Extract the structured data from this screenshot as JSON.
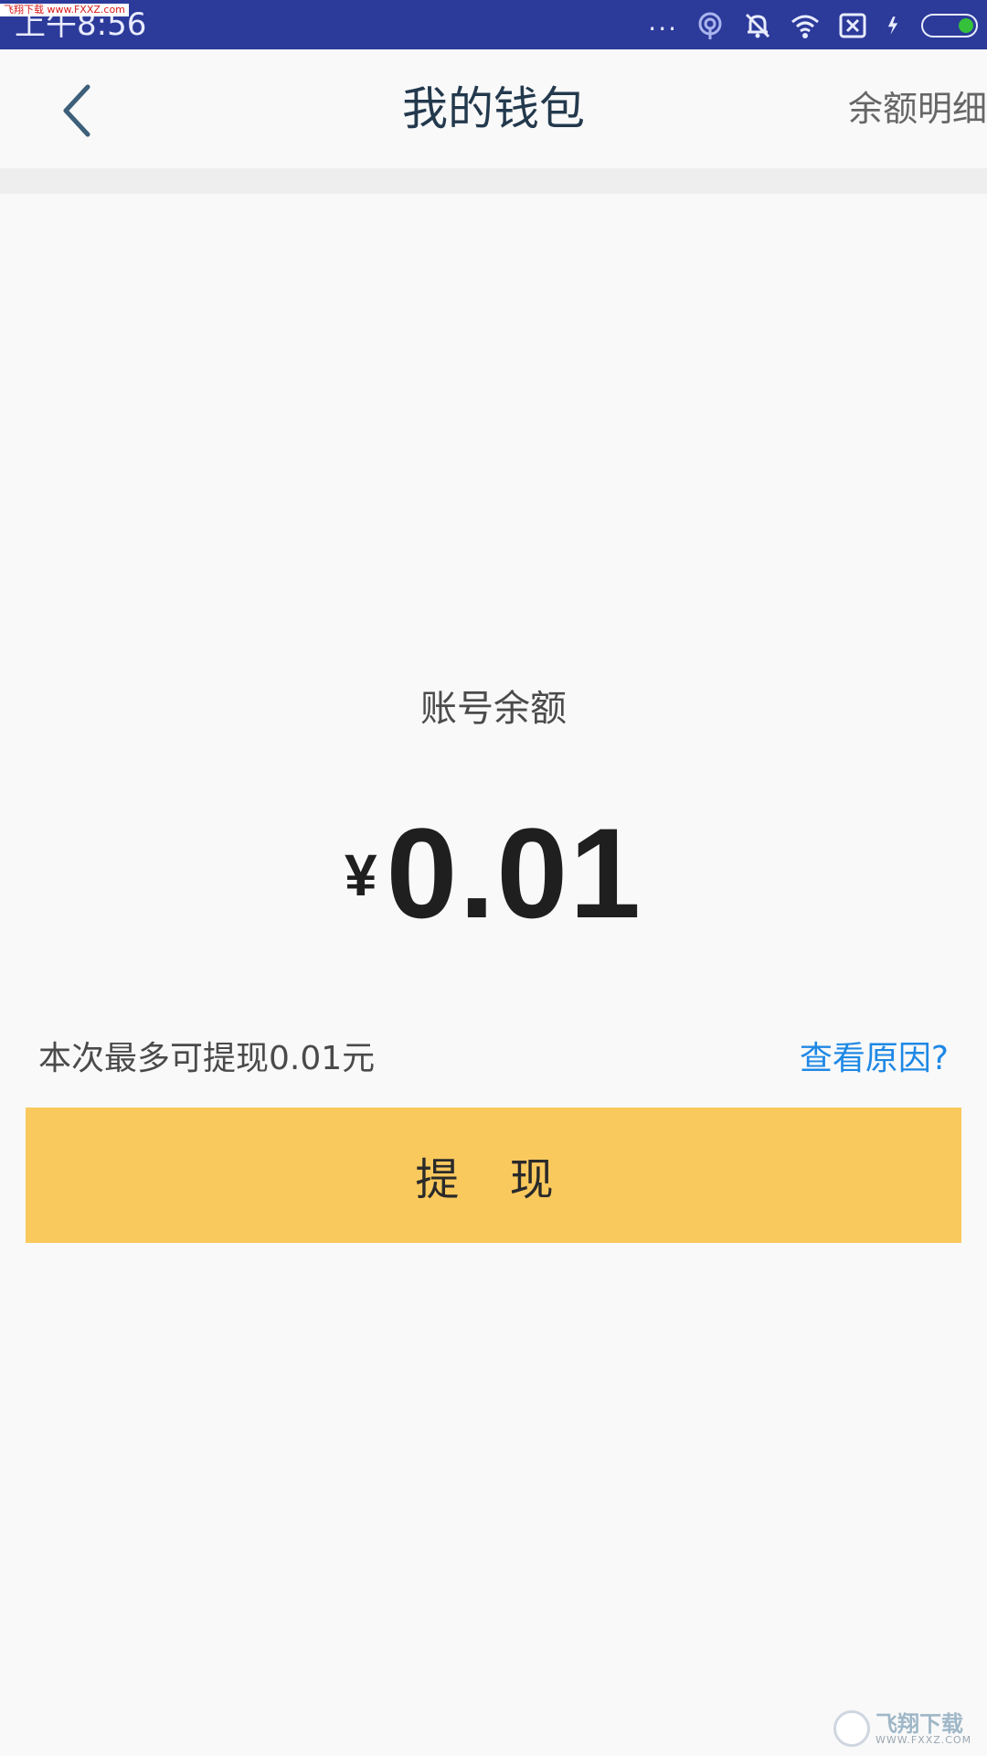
{
  "status_bar": {
    "time": "上午8:56",
    "watermark": "飞翔下载 www.FXXZ.com",
    "dots": "..."
  },
  "header": {
    "title": "我的钱包",
    "right_link": "余额明细"
  },
  "balance": {
    "label": "账号余额",
    "currency": "¥",
    "amount": "0.01"
  },
  "withdraw": {
    "note": "本次最多可提现0.01元",
    "reason_link": "查看原因?",
    "button_label": "提 现"
  },
  "watermark": {
    "brand": "飞翔下载",
    "url": "WWW.FXXZ.COM"
  },
  "colors": {
    "status_bar": "#2c3a9a",
    "button": "#fac95d",
    "link": "#1e88e5"
  }
}
